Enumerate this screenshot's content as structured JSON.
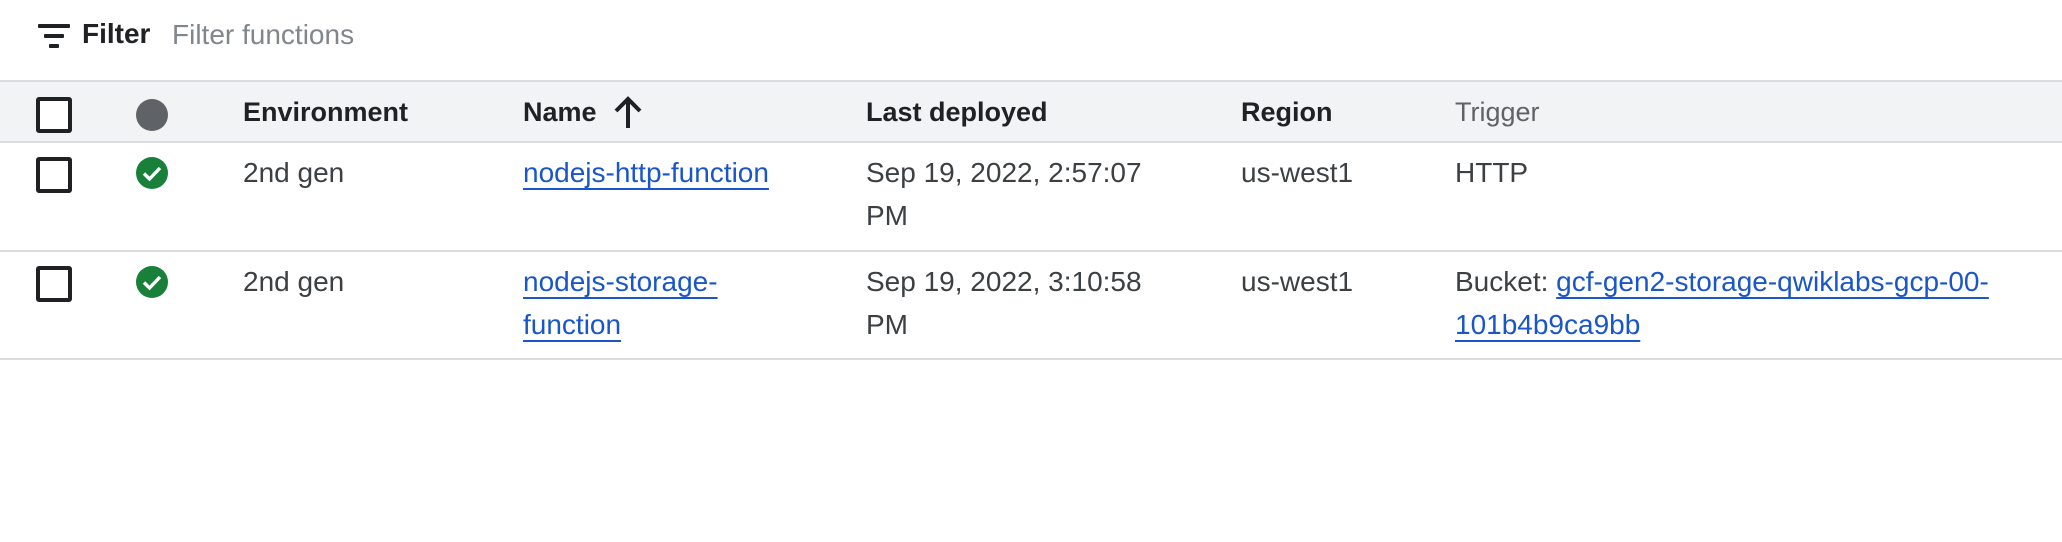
{
  "filter": {
    "label": "Filter",
    "placeholder": "Filter functions",
    "value": ""
  },
  "table": {
    "columns": {
      "environment": "Environment",
      "name": "Name",
      "last_deployed": "Last deployed",
      "region": "Region",
      "trigger": "Trigger"
    },
    "sort": {
      "column": "Name",
      "direction": "ascending",
      "icon": "arrow-up-icon"
    },
    "rows": [
      {
        "environment": "2nd gen",
        "name_line1": "nodejs-http-function",
        "name_line2": "",
        "deployed_line1": "Sep 19, 2022, 2:57:07",
        "deployed_line2": "PM",
        "region": "us-west1",
        "trigger_prefix": "HTTP",
        "trigger_link_line1": "",
        "trigger_link_line2": "",
        "status": "ok"
      },
      {
        "environment": "2nd gen",
        "name_line1": "nodejs-storage-",
        "name_line2": "function",
        "deployed_line1": "Sep 19, 2022, 3:10:58",
        "deployed_line2": "PM",
        "region": "us-west1",
        "trigger_prefix": "Bucket:",
        "trigger_link_line1": "gcf-gen2-storage-qwiklabs-gcp-00-",
        "trigger_link_line2": "101b4b9ca9bb",
        "status": "ok"
      }
    ]
  },
  "colors": {
    "header_bg": "#f1f3f4",
    "link": "#1a56c9",
    "status_ok": "#188038",
    "divider": "#dadce0"
  }
}
